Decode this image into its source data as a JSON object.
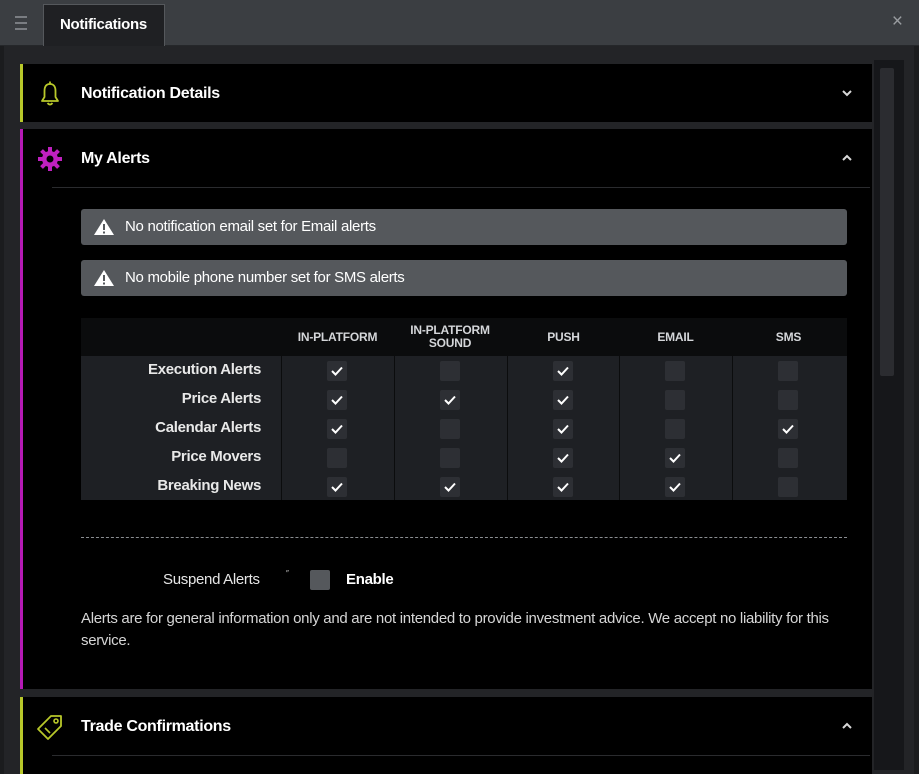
{
  "window": {
    "tab_title": "Notifications",
    "menu_icon": "hamburger-icon",
    "close_icon": "close-icon",
    "close_glyph": "×"
  },
  "panels": {
    "notification_details": {
      "title": "Notification Details",
      "icon": "bell-icon",
      "expanded": false,
      "accent": "#b8c82a"
    },
    "my_alerts": {
      "title": "My Alerts",
      "icon": "gear-icon",
      "expanded": true,
      "accent": "#b51ab5"
    },
    "trade_confirmations": {
      "title": "Trade Confirmations",
      "icon": "tag-icon",
      "expanded": true,
      "accent": "#b8c82a"
    }
  },
  "warnings": [
    "No notification email set for Email alerts",
    "No mobile phone number set for SMS alerts"
  ],
  "alerts_table": {
    "columns": [
      "IN-PLATFORM",
      "IN-PLATFORM SOUND",
      "PUSH",
      "EMAIL",
      "SMS"
    ],
    "rows": [
      {
        "label": "Execution Alerts",
        "checked": [
          true,
          false,
          true,
          false,
          false
        ]
      },
      {
        "label": "Price Alerts",
        "checked": [
          true,
          true,
          true,
          false,
          false
        ]
      },
      {
        "label": "Calendar Alerts",
        "checked": [
          true,
          false,
          true,
          false,
          true
        ]
      },
      {
        "label": "Price Movers",
        "checked": [
          false,
          false,
          true,
          true,
          false
        ]
      },
      {
        "label": "Breaking News",
        "checked": [
          true,
          true,
          true,
          true,
          false
        ]
      }
    ]
  },
  "suspend": {
    "label": "Suspend Alerts",
    "mark": "″",
    "enable_label": "Enable",
    "enabled": false
  },
  "disclaimer": "Alerts are for general information only and are not intended to provide investment advice. We accept no liability for this service.",
  "colors": {
    "lime_accent": "#b8c82a",
    "magenta_accent": "#b51ab5",
    "warning_bg": "#55585c",
    "panel_bg": "#000000"
  }
}
